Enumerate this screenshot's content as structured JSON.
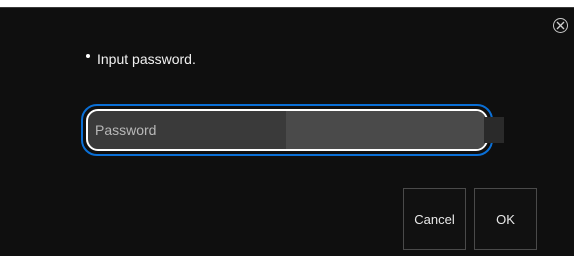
{
  "dialog": {
    "message": "Input password.",
    "password_field": {
      "placeholder": "Password",
      "value": ""
    },
    "buttons": {
      "cancel_label": "Cancel",
      "ok_label": "OK"
    },
    "icons": {
      "close": "close-circle-icon",
      "bullet": "bullet-dot-icon"
    },
    "colors": {
      "background": "#0f0f0f",
      "focus_ring": "#0a6fd6",
      "field_bg": "#3a3a3a",
      "text": "#f2f2f2"
    }
  }
}
